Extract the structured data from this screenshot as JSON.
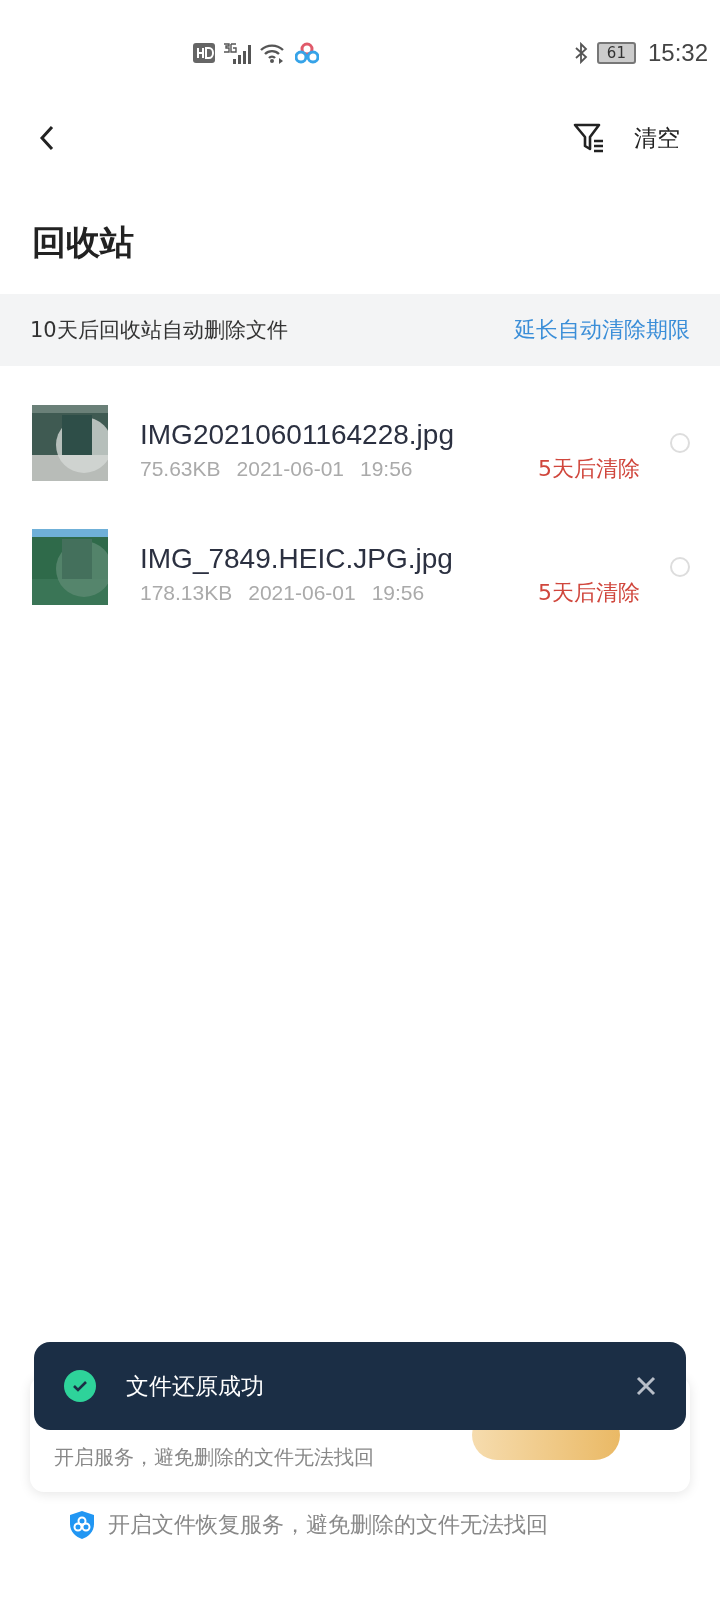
{
  "status_bar": {
    "battery": "61",
    "time": "15:32"
  },
  "header": {
    "action": "清空"
  },
  "title": "回收站",
  "notice": {
    "text": "10天后回收站自动删除文件",
    "link": "延长自动清除期限"
  },
  "files": [
    {
      "name": "IMG20210601164228.jpg",
      "size": "75.63KB",
      "date": "2021-06-01",
      "time": "19:56",
      "expiry": "5天后清除",
      "selected": false
    },
    {
      "name": "IMG_7849.HEIC.JPG.jpg",
      "size": "178.13KB",
      "date": "2021-06-01",
      "time": "19:56",
      "expiry": "5天后清除",
      "selected": false
    }
  ],
  "promo_card": {
    "subtitle": "开启服务，避免删除的文件无法找回"
  },
  "toast": {
    "message": "文件还原成功"
  },
  "footer": {
    "text": "开启文件恢复服务，避免删除的文件无法找回"
  }
}
